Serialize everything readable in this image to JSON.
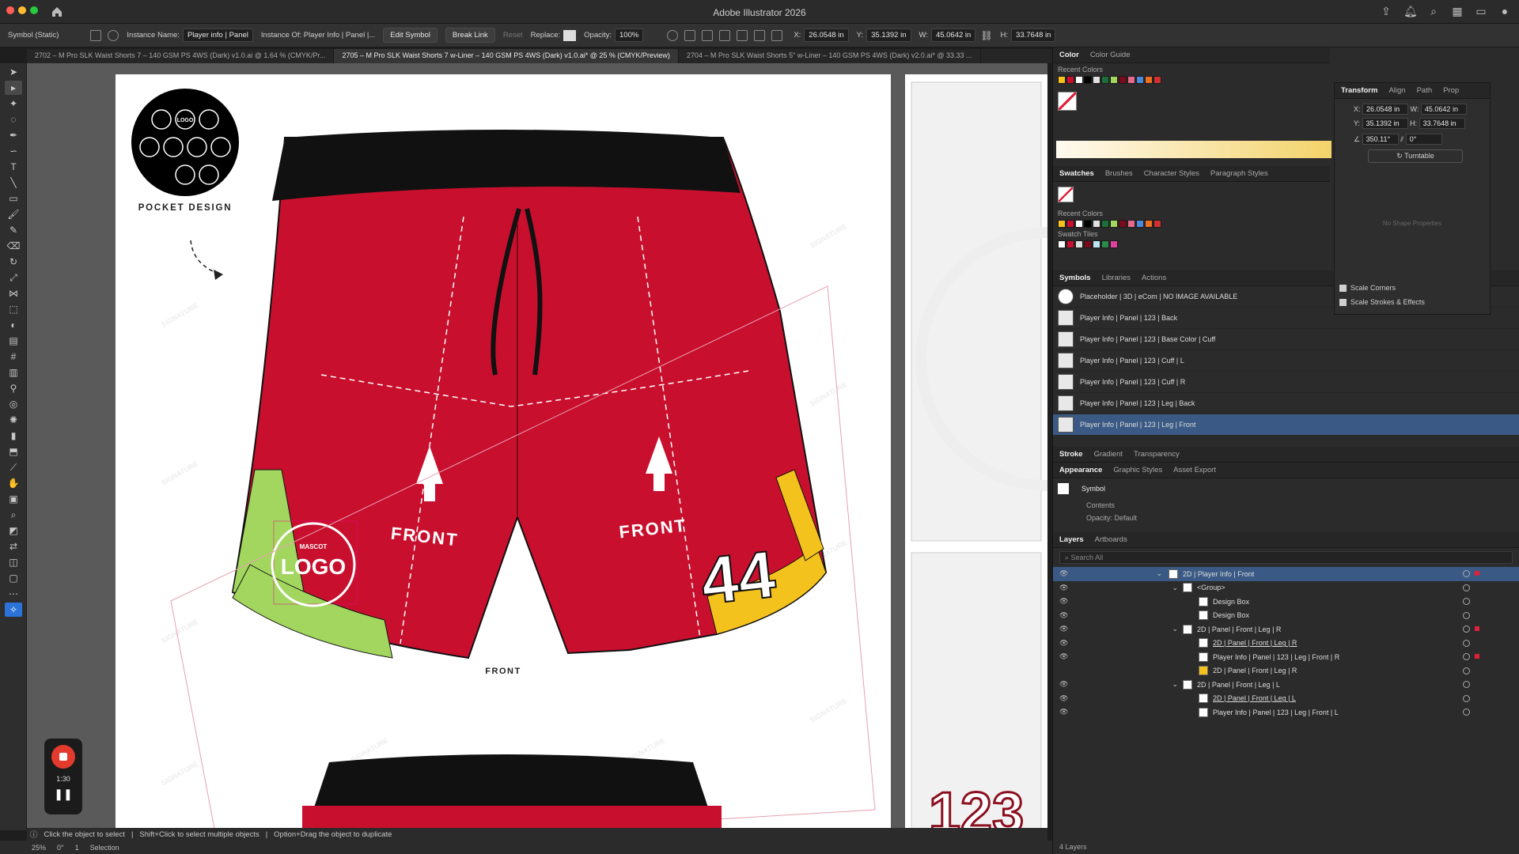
{
  "app": {
    "title": "Adobe Illustrator 2026"
  },
  "control": {
    "mode": "Symbol (Static)",
    "instance_name_label": "Instance Name:",
    "instance_name": "Player info | Panel",
    "instance_of": "Instance Of: Player Info | Panel |...",
    "edit_symbol": "Edit Symbol",
    "break_link": "Break Link",
    "reset": "Reset",
    "replace_label": "Replace:",
    "opacity_label": "Opacity:",
    "opacity": "100%",
    "x_label": "X:",
    "x": "26.0548 in",
    "y_label": "Y:",
    "y": "35.1392 in",
    "w_label": "W:",
    "w": "45.0642 in",
    "h_label": "H:",
    "h": "33.7648 in"
  },
  "tabs": [
    "2702 – M Pro SLK Waist Shorts 7 – 140 GSM PS 4WS (Dark) v1.0.ai @ 1.64 % (CMYK/Pr...",
    "2705 – M Pro SLK Waist Shorts 7 w-Liner – 140 GSM PS 4WS (Dark) v1.0.ai* @ 25 % (CMYK/Preview)",
    "2704 – M Pro SLK Waist Shorts 5\" w-Liner – 140 GSM PS 4WS (Dark) v2.0.ai* @ 33.33 ..."
  ],
  "artwork": {
    "pocket_label": "POCKET DESIGN",
    "logo_small": "LOGO",
    "front_left": "FRONT",
    "front_right": "FRONT",
    "front_bottom": "FRONT",
    "mascot": "MASCOT",
    "logo_big": "LOGO",
    "number": "44",
    "number_bottom": "123"
  },
  "recorder": {
    "time": "1:30"
  },
  "status": {
    "hint1": "Click the object to select",
    "hint2": "Shift+Click to select multiple objects",
    "hint3": "Option+Drag the object to duplicate",
    "zoom": "25%",
    "rotate": "0°",
    "artboard": "1",
    "tool": "Selection"
  },
  "color_panel": {
    "tabs": [
      "Color",
      "Color Guide"
    ],
    "recent_label": "Recent Colors"
  },
  "transform_panel": {
    "tabs": [
      "Transform",
      "Align",
      "Path",
      "Prop"
    ],
    "x_label": "X:",
    "x": "26.0548 in",
    "y_label": "Y:",
    "y": "35.1392 in",
    "w_label": "W:",
    "w": "45.0642 in",
    "h_label": "H:",
    "h": "33.7648 in",
    "angle": "350.11°",
    "shear": "0°",
    "turntable": "Turntable",
    "no_shape": "No Shape Properties",
    "scale_corners": "Scale Corners",
    "scale_strokes": "Scale Strokes & Effects"
  },
  "swatches_panel": {
    "tabs": [
      "Swatches",
      "Brushes",
      "Character Styles",
      "Paragraph Styles"
    ],
    "recent_label": "Recent Colors",
    "tiles_label": "Swatch Tiles"
  },
  "symbols_panel": {
    "tabs": [
      "Symbols",
      "Libraries",
      "Actions"
    ],
    "items": [
      "Placeholder | 3D | eCom | NO IMAGE AVAILABLE",
      "Player Info | Panel | 123 | Back",
      "Player Info | Panel | 123 | Base Color | Cuff",
      "Player Info | Panel | 123 | Cuff | L",
      "Player Info | Panel | 123 | Cuff | R",
      "Player Info | Panel | 123 | Leg | Back",
      "Player Info | Panel | 123 | Leg | Front"
    ]
  },
  "stroke_tabs": [
    "Stroke",
    "Gradient",
    "Transparency"
  ],
  "appearance_panel": {
    "tabs": [
      "Appearance",
      "Graphic Styles",
      "Asset Export"
    ],
    "symbol": "Symbol",
    "contents": "Contents",
    "opacity": "Opacity: Default"
  },
  "layers_panel": {
    "tabs": [
      "Layers",
      "Artboards"
    ],
    "search": "Search All",
    "rows": [
      "2D | Player Info | Front",
      "<Group>",
      "Design Box",
      "Design Box",
      "2D | Panel | Front | Leg | R",
      "2D | Panel | Front | Leg | R",
      "Player Info | Panel | 123 | Leg | Front | R",
      "2D | Panel | Front | Leg | R",
      "2D | Panel | Front | Leg | L",
      "2D | Panel | Front | Leg | L",
      "Player Info | Panel | 123 | Leg | Front | L"
    ],
    "count": "4 Layers"
  },
  "colors": {
    "accent": "#3a5a85",
    "red": "#c8102e",
    "green": "#a2d65f",
    "yellow": "#f4c21c"
  }
}
